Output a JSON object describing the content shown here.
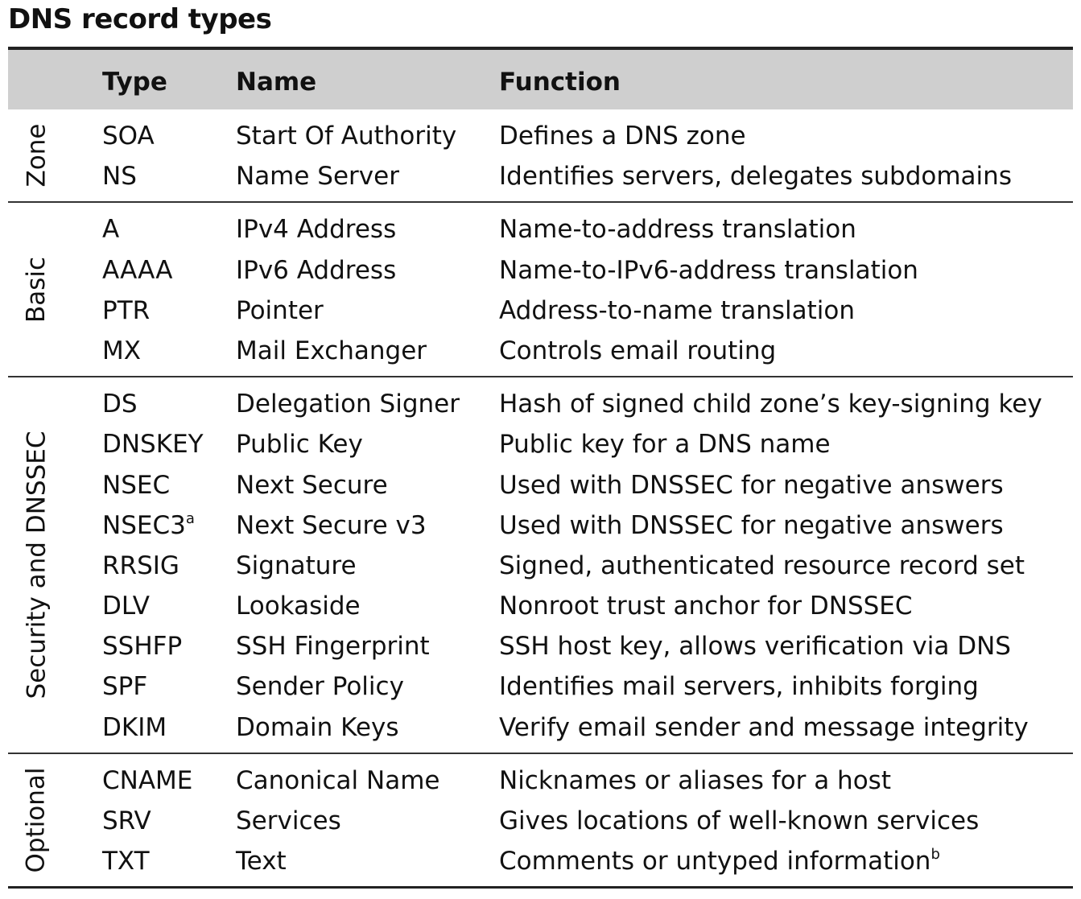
{
  "title": "DNS record types",
  "headers": {
    "type": "Type",
    "name": "Name",
    "function": "Function"
  },
  "groups": [
    {
      "label": "Zone",
      "rows": [
        {
          "type": "SOA",
          "name": "Start Of Authority",
          "function": "Defines a DNS zone"
        },
        {
          "type": "NS",
          "name": "Name Server",
          "function": "Identifies servers, delegates subdomains"
        }
      ]
    },
    {
      "label": "Basic",
      "rows": [
        {
          "type": "A",
          "name": "IPv4 Address",
          "function": "Name-to-address translation"
        },
        {
          "type": "AAAA",
          "name": "IPv6 Address",
          "function": "Name-to-IPv6-address translation"
        },
        {
          "type": "PTR",
          "name": "Pointer",
          "function": "Address-to-name translation"
        },
        {
          "type": "MX",
          "name": "Mail Exchanger",
          "function": "Controls email routing"
        }
      ]
    },
    {
      "label": "Security and DNSSEC",
      "rows": [
        {
          "type": "DS",
          "name": "Delegation Signer",
          "function": "Hash of signed child zone’s key-signing key"
        },
        {
          "type": "DNSKEY",
          "name": "Public Key",
          "function": "Public key for a DNS name"
        },
        {
          "type": "NSEC",
          "name": "Next Secure",
          "function": "Used with DNSSEC for negative answers"
        },
        {
          "type": "NSEC3",
          "type_note": "a",
          "name": "Next Secure v3",
          "function": "Used with DNSSEC for negative answers"
        },
        {
          "type": "RRSIG",
          "name": "Signature",
          "function": "Signed, authenticated resource record set"
        },
        {
          "type": "DLV",
          "name": "Lookaside",
          "function": "Nonroot trust anchor for DNSSEC"
        },
        {
          "type": "SSHFP",
          "name": "SSH Fingerprint",
          "function": "SSH host key, allows verification via DNS"
        },
        {
          "type": "SPF",
          "name": "Sender Policy",
          "function": "Identifies mail servers, inhibits forging"
        },
        {
          "type": "DKIM",
          "name": "Domain Keys",
          "function": "Verify email sender and message integrity"
        }
      ]
    },
    {
      "label": "Optional",
      "rows": [
        {
          "type": "CNAME",
          "name": "Canonical Name",
          "function": "Nicknames or aliases for a host"
        },
        {
          "type": "SRV",
          "name": "Services",
          "function": "Gives locations of well-known services"
        },
        {
          "type": "TXT",
          "name": "Text",
          "function": "Comments or untyped information",
          "function_note": "b"
        }
      ]
    }
  ]
}
